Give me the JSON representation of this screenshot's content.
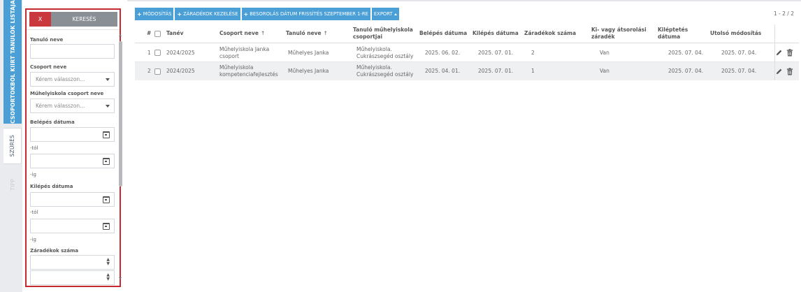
{
  "side_tabs": {
    "list": "CSOPORTOKBÓL KIÍRT TANULÓK LISTÁJA",
    "filter": "SZŰRÉS",
    "tip": "TIPP"
  },
  "filter": {
    "x_button": "X",
    "search_button": "KERESÉS",
    "student_name_label": "Tanuló neve",
    "group_name_label": "Csoport neve",
    "group_name_placeholder": "Kérem válasszon...",
    "workshop_group_label": "Műhelyiskola csoport neve",
    "workshop_group_placeholder": "Kérem válasszon...",
    "entry_date_label": "Belépés dátuma",
    "from_label": "-tól",
    "to_label": "-ig",
    "exit_date_label": "Kilépés dátuma",
    "exit_from_label": "-tól",
    "exit_to_label": "-ig",
    "clause_count_label": "Záradékok száma"
  },
  "toolbar": {
    "modify": "MÓDOSÍTÁS",
    "clauses": "ZÁRADÉKOK KEZELÉSE",
    "refresh": "BESOROLÁS DÁTUM FRISSÍTÉS SZEPTEMBER 1-RE",
    "export": "EXPORT"
  },
  "pager": "1 - 2 / 2",
  "table": {
    "headers": {
      "num": "#",
      "year": "Tanév",
      "group": "Csoport neve",
      "student": "Tanuló neve",
      "workshop": "Tanuló műhelyiskola csoportjai",
      "entry": "Belépés dátuma",
      "exit": "Kilépés dátuma",
      "clauses": "Záradékok száma",
      "transfer": "Ki- vagy átsorolási záradék",
      "exit_record": "Kiléptetés dátuma",
      "modified": "Utolsó módosítás"
    },
    "rows": [
      {
        "num": "1",
        "year": "2024/2025",
        "group": "Műhelyiskola Janka csoport",
        "student": "Műhelyes Janka",
        "workshop": "Műhelyiskola. Cukrászsegéd osztály",
        "entry": "2025. 06. 02.",
        "exit": "2025. 07. 01.",
        "clauses": "2",
        "transfer": "Van",
        "exit_record": "2025. 07. 04.",
        "modified": "2025. 07. 04."
      },
      {
        "num": "2",
        "year": "2024/2025",
        "group": "Műhelyiskola kompetenciafejlesztés",
        "student": "Műhelyes Janka",
        "workshop": "Műhelyiskola. Cukrászsegéd osztály",
        "entry": "2025. 04. 01.",
        "exit": "2025. 07. 01.",
        "clauses": "1",
        "transfer": "Van",
        "exit_record": "2025. 07. 04.",
        "modified": "2025. 07. 04."
      }
    ]
  },
  "colors": {
    "accent": "#4a9fd6",
    "danger": "#c9383c",
    "filter_outline": "#c52a30"
  }
}
